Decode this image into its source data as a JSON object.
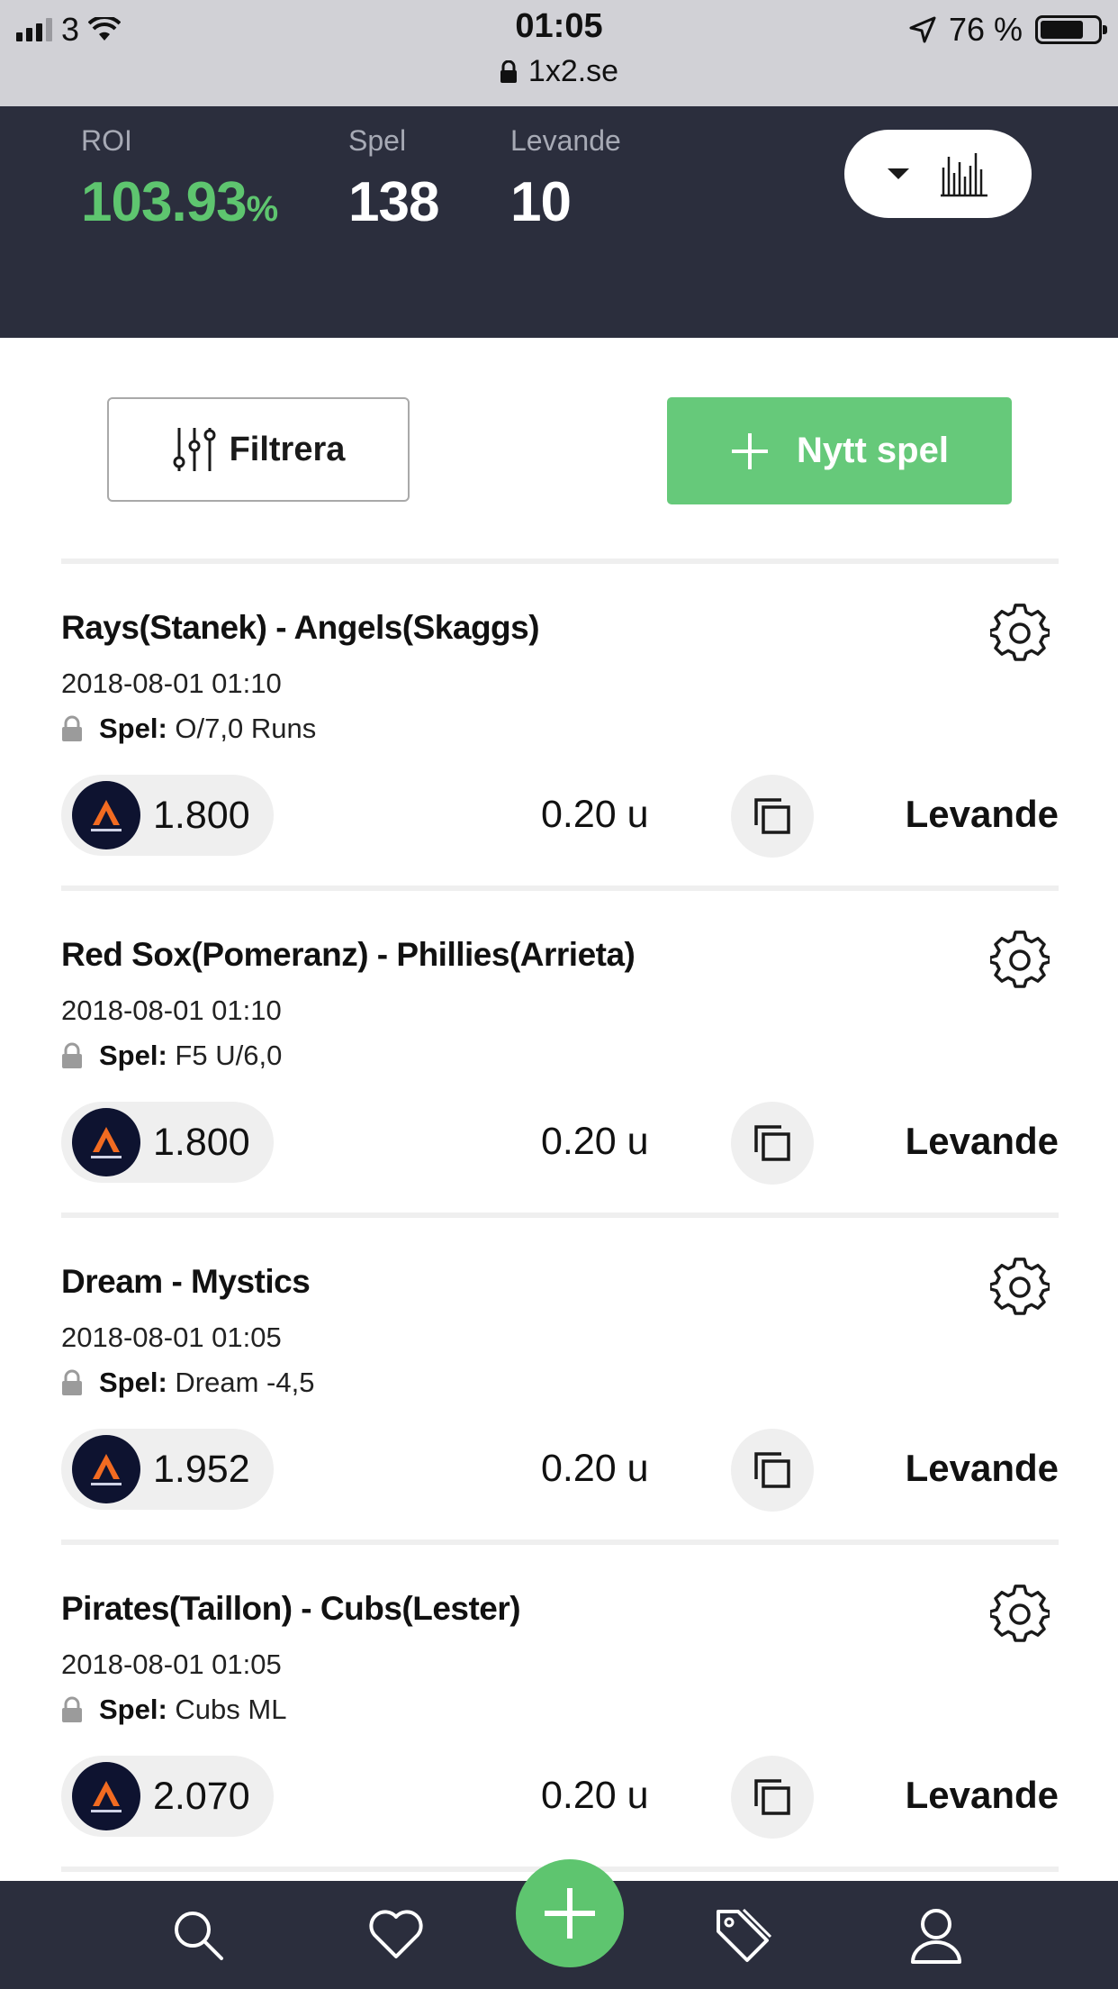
{
  "status_bar": {
    "carrier": "3",
    "time": "01:05",
    "url": "1x2.se",
    "battery": "76 %"
  },
  "stats": {
    "roi_label": "ROI",
    "roi_value": "103.93",
    "roi_unit": "%",
    "bets_label": "Spel",
    "bets_value": "138",
    "live_label": "Levande",
    "live_value": "10"
  },
  "actions": {
    "filter_label": "Filtrera",
    "new_bet_label": "Nytt spel"
  },
  "bets": [
    {
      "title": "Rays(Stanek) - Angels(Skaggs)",
      "date": "2018-08-01 01:10",
      "pick_label": "Spel:",
      "pick": "O/7,0 Runs",
      "odds": "1.800",
      "stake": "0.20 u",
      "status": "Levande"
    },
    {
      "title": "Red Sox(Pomeranz) - Phillies(Arrieta)",
      "date": "2018-08-01 01:10",
      "pick_label": "Spel:",
      "pick": "F5 U/6,0",
      "odds": "1.800",
      "stake": "0.20 u",
      "status": "Levande"
    },
    {
      "title": "Dream - Mystics",
      "date": "2018-08-01 01:05",
      "pick_label": "Spel:",
      "pick": "Dream -4,5",
      "odds": "1.952",
      "stake": "0.20 u",
      "status": "Levande"
    },
    {
      "title": "Pirates(Taillon) - Cubs(Lester)",
      "date": "2018-08-01 01:05",
      "pick_label": "Spel:",
      "pick": "Cubs ML",
      "odds": "2.070",
      "stake": "0.20 u",
      "status": "Levande"
    }
  ],
  "icons": {
    "nav": [
      "search-icon",
      "heart-icon",
      "plus-icon",
      "tag-icon",
      "user-icon"
    ]
  },
  "colors": {
    "header_bg": "#2b2e3d",
    "accent_green": "#5ec56f",
    "button_green": "#66c97a"
  }
}
